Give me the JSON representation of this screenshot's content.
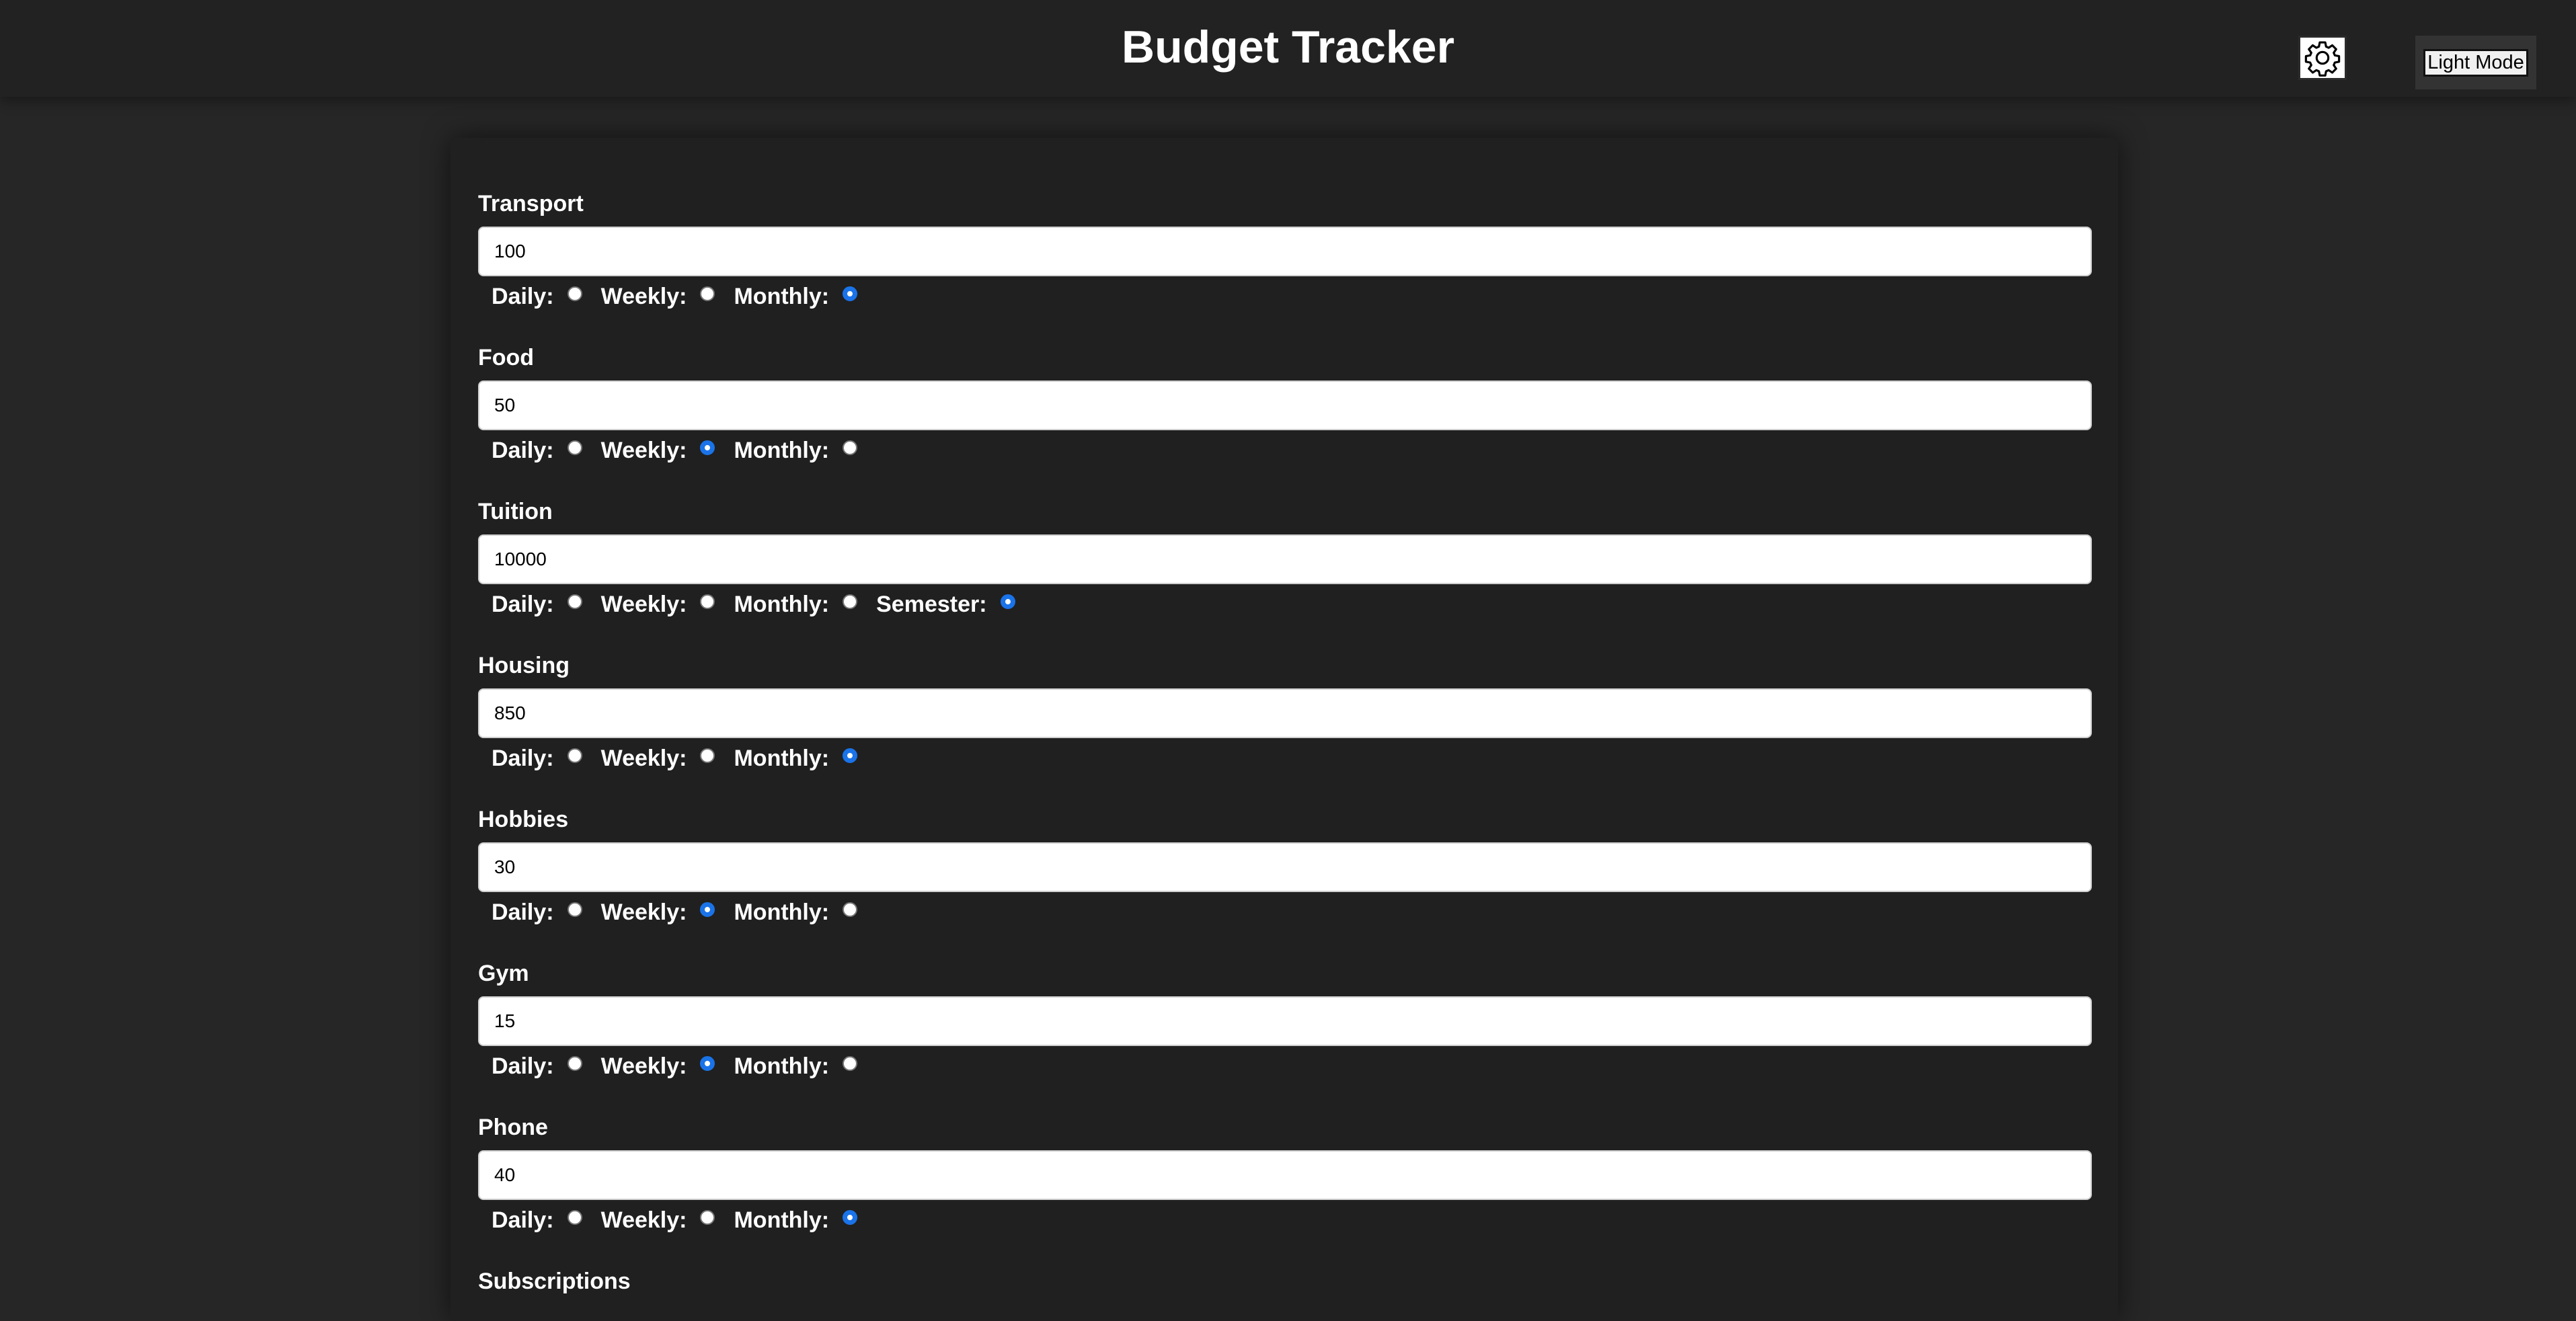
{
  "app": {
    "title": "Budget Tracker",
    "mode_button_label": "Light Mode",
    "settings_icon": "gear-icon"
  },
  "colors": {
    "page_background": "#262626",
    "header_background": "#222222",
    "panel_background": "#202020",
    "radio_checked": "#1a73e8"
  },
  "categories": [
    {
      "label": "Transport",
      "value": "100",
      "options": [
        "Daily:",
        "Weekly:",
        "Monthly:"
      ],
      "selected": 2
    },
    {
      "label": "Food",
      "value": "50",
      "options": [
        "Daily:",
        "Weekly:",
        "Monthly:"
      ],
      "selected": 1
    },
    {
      "label": "Tuition",
      "value": "10000",
      "options": [
        "Daily:",
        "Weekly:",
        "Monthly:",
        "Semester:"
      ],
      "selected": 3
    },
    {
      "label": "Housing",
      "value": "850",
      "options": [
        "Daily:",
        "Weekly:",
        "Monthly:"
      ],
      "selected": 2
    },
    {
      "label": "Hobbies",
      "value": "30",
      "options": [
        "Daily:",
        "Weekly:",
        "Monthly:"
      ],
      "selected": 1
    },
    {
      "label": "Gym",
      "value": "15",
      "options": [
        "Daily:",
        "Weekly:",
        "Monthly:"
      ],
      "selected": 1
    },
    {
      "label": "Phone",
      "value": "40",
      "options": [
        "Daily:",
        "Weekly:",
        "Monthly:"
      ],
      "selected": 2
    },
    {
      "label": "Subscriptions",
      "value": "",
      "options": [],
      "selected": -1
    }
  ]
}
